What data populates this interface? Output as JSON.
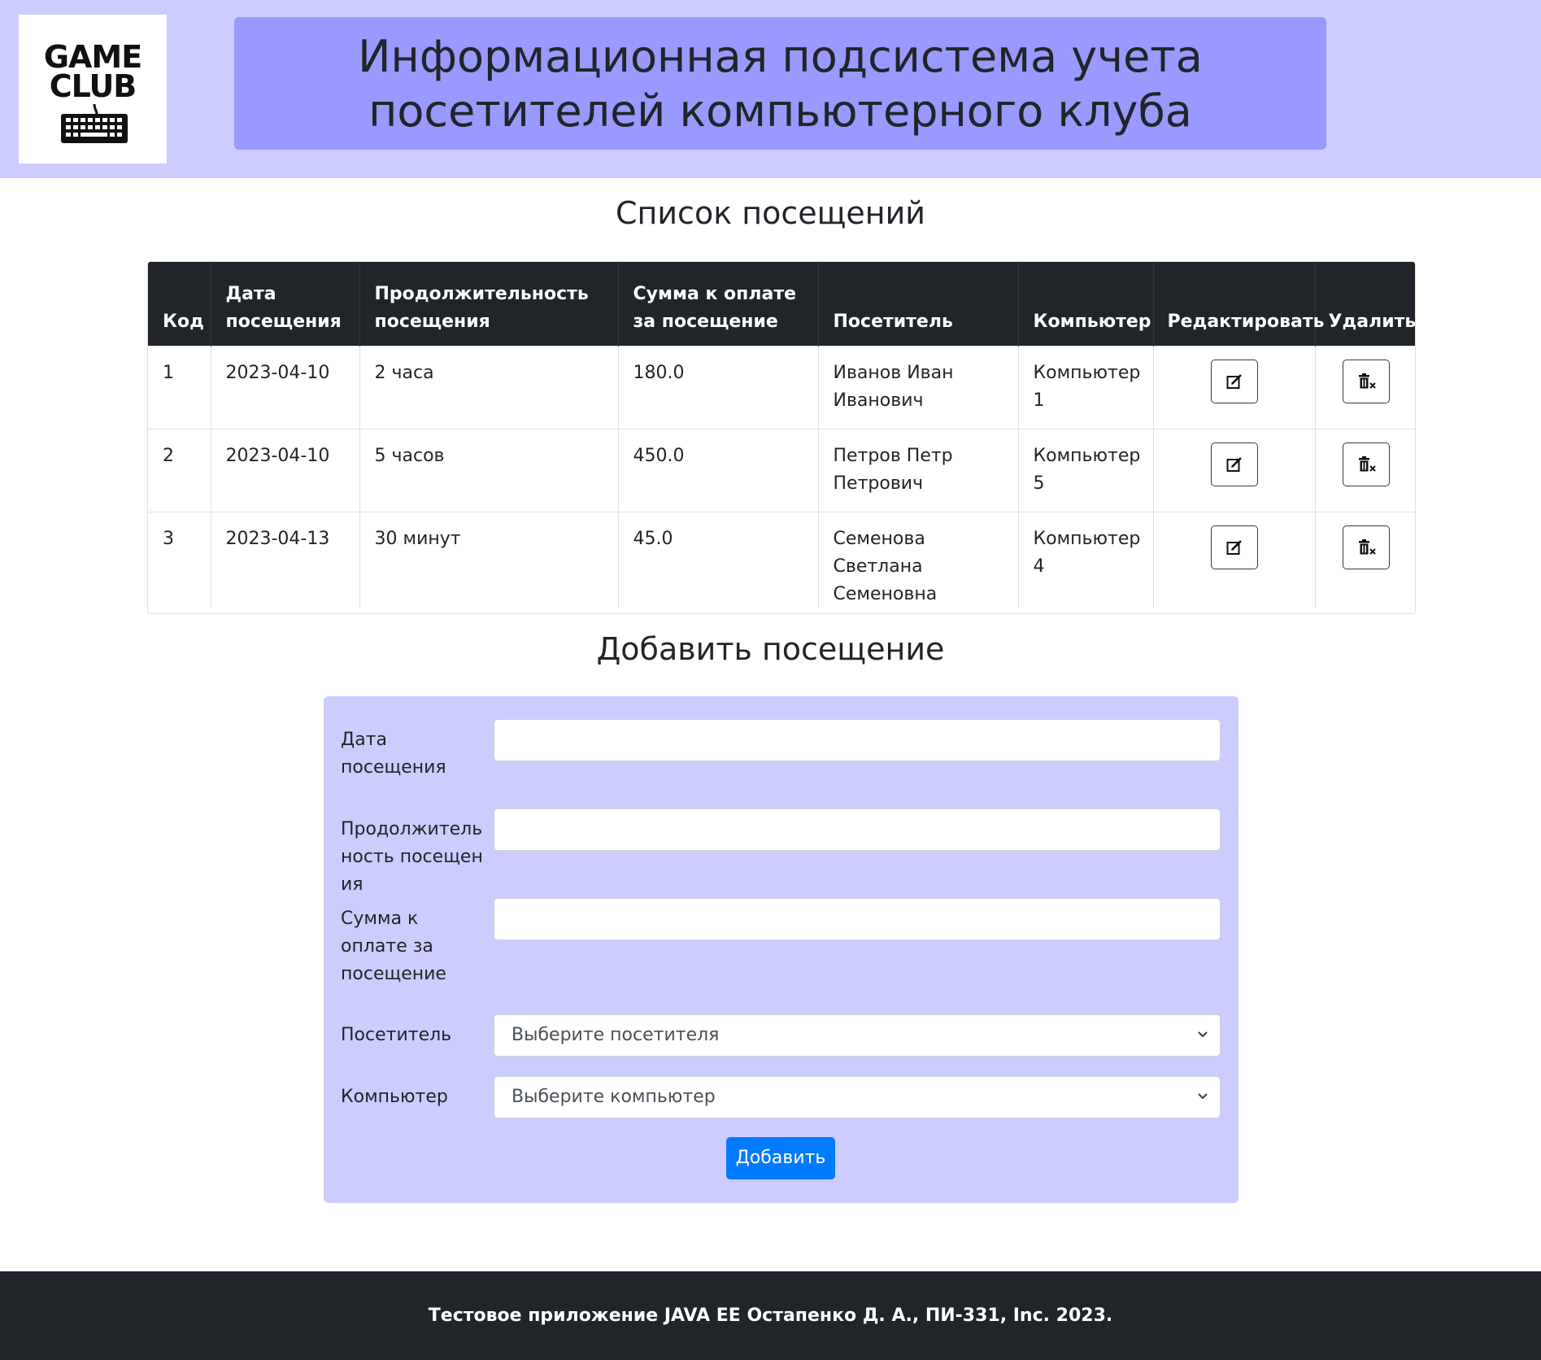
{
  "header": {
    "logo_line1": "GAME",
    "logo_line2": "CLUB",
    "title": "Информационная подсистема учета посетителей компьютерного клуба"
  },
  "list_heading": "Список посещений",
  "table": {
    "columns": [
      "Код",
      "Дата посещения",
      "Продолжительность посещения",
      "Сумма к оплате за посещение",
      "Посетитель",
      "Компьютер",
      "Редактировать",
      "Удалить"
    ],
    "rows": [
      {
        "code": "1",
        "date": "2023-04-10",
        "duration": "2 часа",
        "sum": "180.0",
        "visitor": "Иванов Иван Иванович",
        "computer": "Компьютер 1"
      },
      {
        "code": "2",
        "date": "2023-04-10",
        "duration": "5 часов",
        "sum": "450.0",
        "visitor": "Петров Петр Петрович",
        "computer": "Компьютер 5"
      },
      {
        "code": "3",
        "date": "2023-04-13",
        "duration": "30 минут",
        "sum": "45.0",
        "visitor": "Семенова Светлана Семеновна",
        "computer": "Компьютер 4"
      }
    ]
  },
  "form": {
    "heading": "Добавить посещение",
    "date_label": "Дата посещения",
    "date_value": "",
    "duration_label": "Продолжительность посещения",
    "duration_value": "",
    "sum_label": "Сумма к оплате за посещение",
    "sum_value": "",
    "visitor_label": "Посетитель",
    "visitor_selected": "Выберите посетителя",
    "computer_label": "Компьютер",
    "computer_selected": "Выберите компьютер",
    "submit_label": "Добавить"
  },
  "footer": {
    "text": "Тестовое приложение JAVA EE Остапенко Д. А., ПИ-331, Inc. 2023."
  },
  "colors": {
    "header_bg": "#ccccff",
    "title_bg": "#9999ff",
    "form_bg": "#ccccff",
    "table_head_bg": "#212529",
    "footer_bg": "#212529",
    "primary_button": "#007bff"
  }
}
